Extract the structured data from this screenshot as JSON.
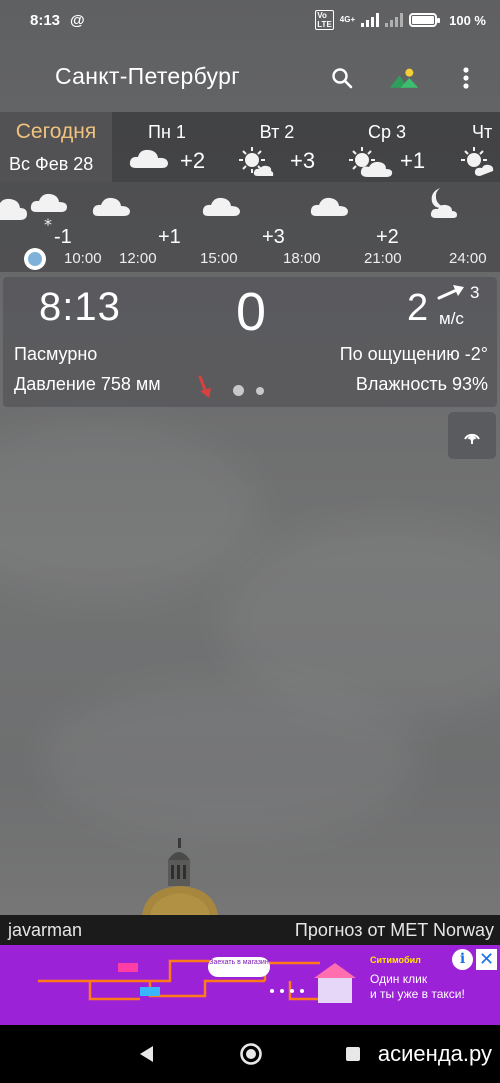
{
  "status_bar": {
    "time": "8:13",
    "at_symbol": "@",
    "volte": "Vo LTE",
    "network": "4G+",
    "battery": "100 %",
    "battery_level": 1.0
  },
  "header": {
    "city": "Санкт-Петербург",
    "icons": [
      "search-icon",
      "wallpaper-icon",
      "more-vert-icon"
    ]
  },
  "days": [
    {
      "name": "Сегодня",
      "sub": "Вс Фев 28",
      "active": true
    },
    {
      "name": "Пн 1",
      "icon": "cloud-icon",
      "temp": "+2"
    },
    {
      "name": "Вт 2",
      "icon": "sun-cloud-icon",
      "temp": "+3"
    },
    {
      "name": "Ср 3",
      "icon": "sun-cloud-icon",
      "temp": "+1"
    },
    {
      "name": "Чт",
      "icon": "sun-cloud-icon",
      "temp": ""
    }
  ],
  "hourly": {
    "temps": [
      "-1",
      "+1",
      "+3",
      "+2"
    ],
    "times": [
      "10:00",
      "12:00",
      "15:00",
      "18:00",
      "21:00",
      "24:00"
    ],
    "icons": [
      "snow-cloud-icon",
      "cloud-icon",
      "cloud-icon",
      "cloud-icon",
      "moon-cloud-icon"
    ]
  },
  "current": {
    "time": "8:13",
    "temp": "0",
    "wind": "2",
    "gust": "3",
    "wind_unit": "м/с",
    "condition": "Пасмурно",
    "feels_like": "По ощущению -2°",
    "pressure": "Давление 758 мм",
    "humidity": "Влажность 93%"
  },
  "footer": {
    "author": "javarman",
    "source": "Прогноз от MET Norway"
  },
  "ad": {
    "brand": "Ситимобил",
    "pill": "Заехать в магазин",
    "line1": "Один клик",
    "line2": "и ты уже в такси!",
    "info": "i",
    "close": "✕",
    "bg_color": "#9c22d8"
  },
  "watermark": "асиенда.ру",
  "colors": {
    "accent_today": "#f1c27d",
    "pressure_arrow": "#d94040"
  }
}
